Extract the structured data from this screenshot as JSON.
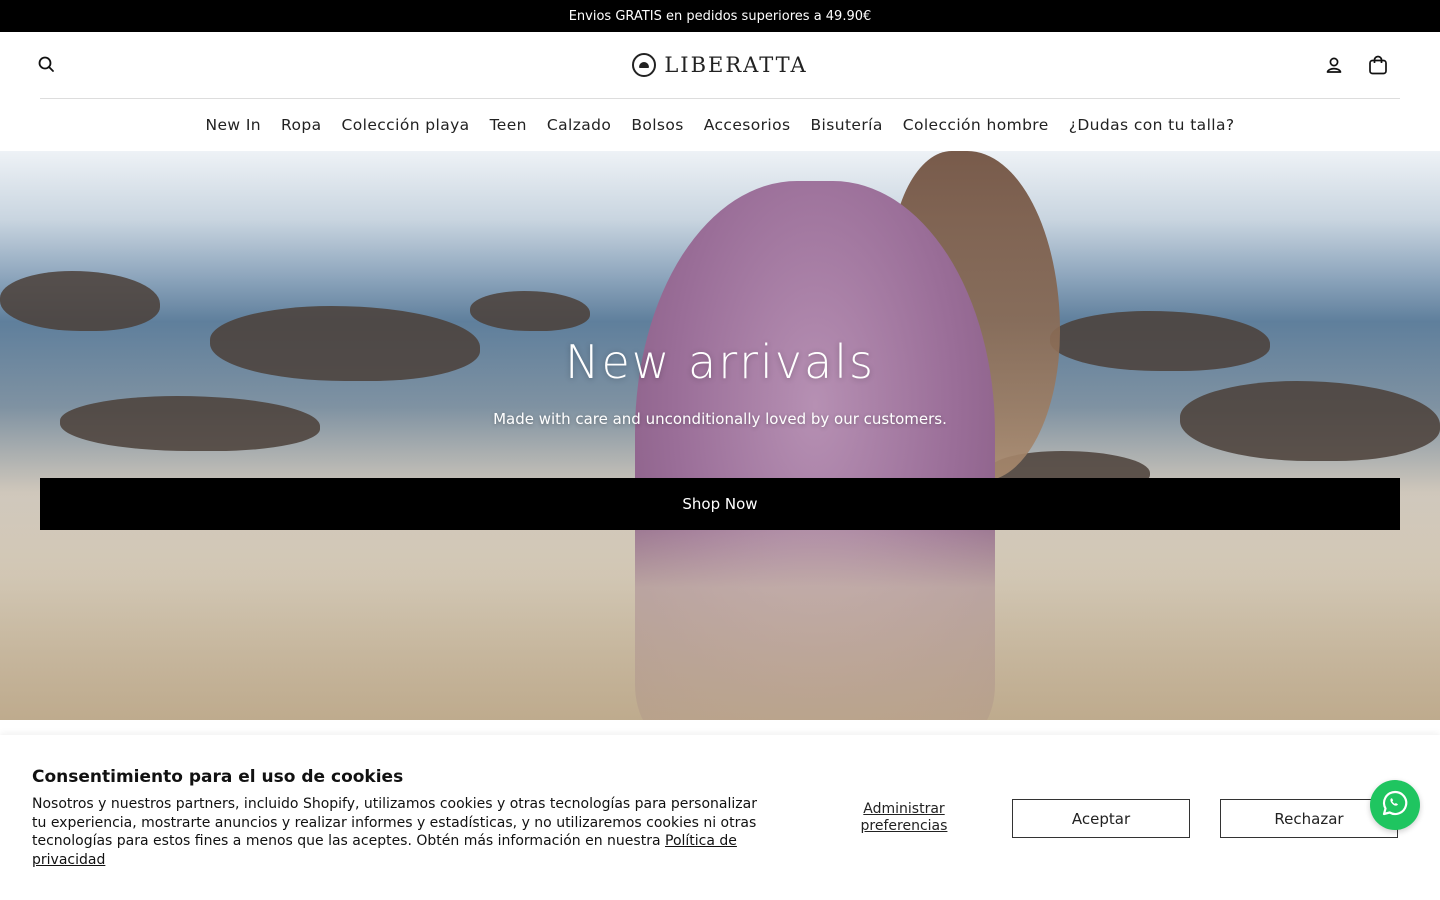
{
  "announcement": {
    "text": "Envios GRATIS en pedidos superiores a 49.90€"
  },
  "header": {
    "logo_text": "LIBERATTA",
    "icons": {
      "search": "search-icon",
      "account": "user-icon",
      "cart": "shopping-bag-icon"
    }
  },
  "nav": {
    "items": [
      {
        "label": "New In"
      },
      {
        "label": "Ropa"
      },
      {
        "label": "Colección playa"
      },
      {
        "label": "Teen"
      },
      {
        "label": "Calzado"
      },
      {
        "label": "Bolsos"
      },
      {
        "label": "Accesorios"
      },
      {
        "label": "Bisutería"
      },
      {
        "label": "Colección hombre"
      },
      {
        "label": "¿Dudas con tu talla?"
      }
    ]
  },
  "hero": {
    "title": "New arrivals",
    "subtitle": "Made with care and unconditionally loved by our customers.",
    "button_label": "Shop Now"
  },
  "cookie_banner": {
    "title": "Consentimiento para el uso de cookies",
    "text": "Nosotros y nuestros partners, incluido Shopify, utilizamos cookies y otras tecnologías para personalizar tu experiencia, mostrarte anuncios y realizar informes y estadísticas, y no utilizaremos cookies ni otras tecnologías para estos fines a menos que las aceptes. Obtén más información en nuestra ",
    "privacy_link": "Política de privacidad",
    "manage_label": "Administrar preferencias",
    "accept_label": "Aceptar",
    "reject_label": "Rechazar"
  },
  "whatsapp": {
    "icon": "whatsapp-icon",
    "color": "#1fc560"
  },
  "colors": {
    "announcement_bg": "#000000",
    "button_bg": "#000000",
    "text": "#111111"
  }
}
